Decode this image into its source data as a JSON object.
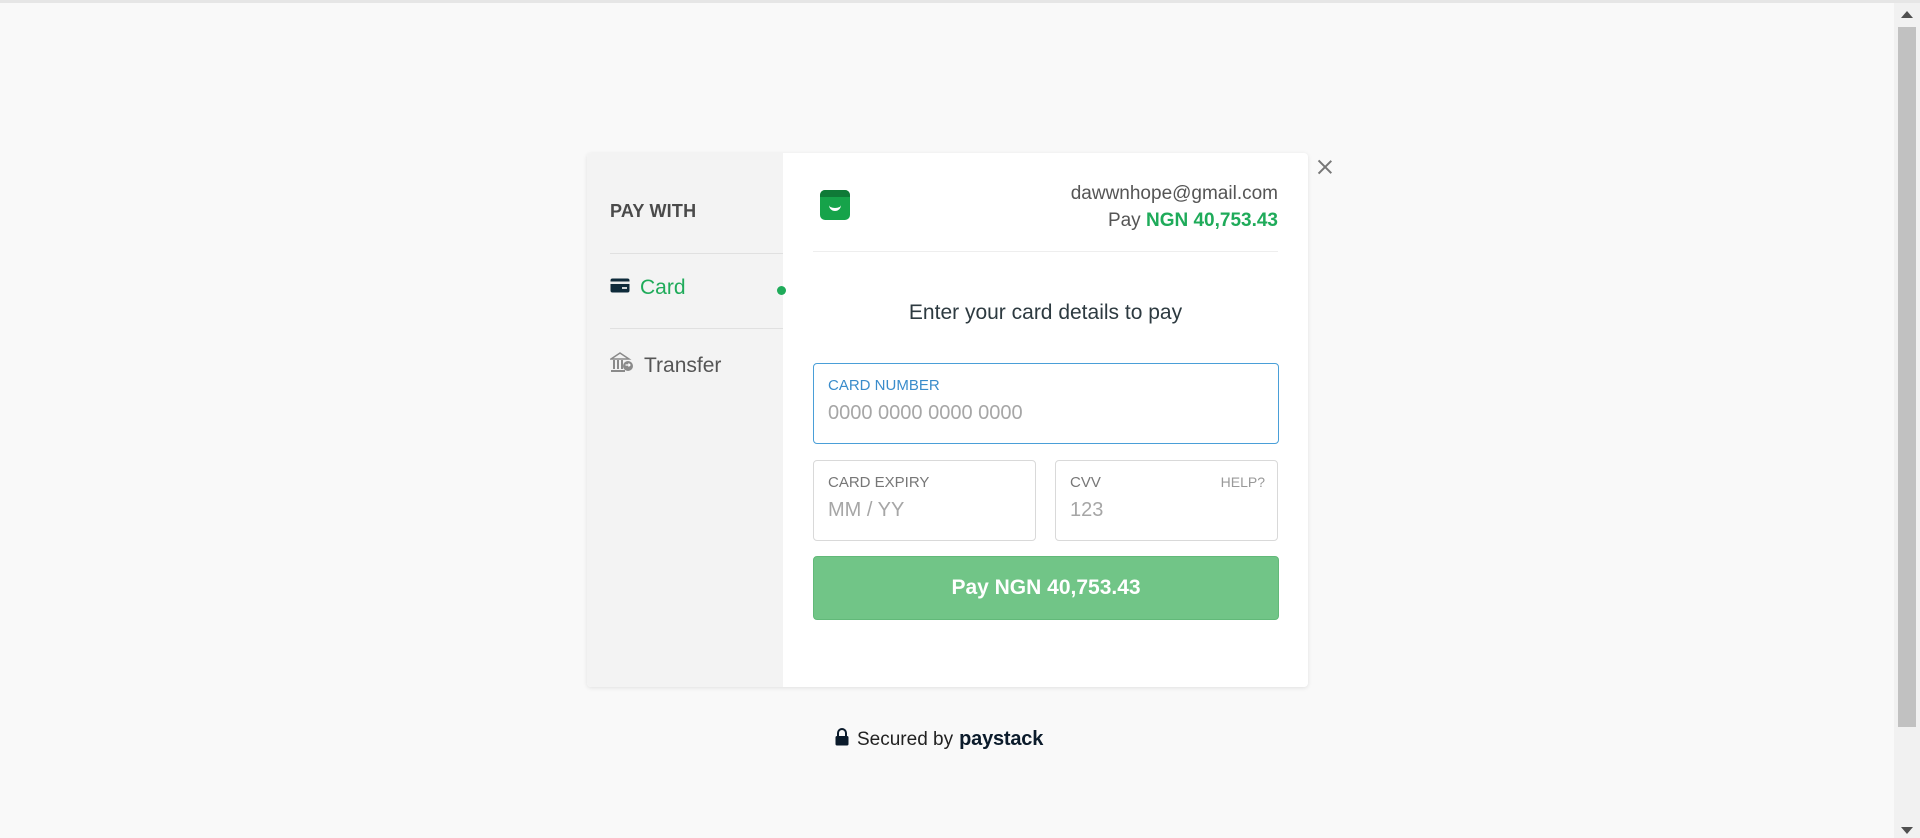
{
  "sidebar": {
    "title": "PAY WITH",
    "items": [
      {
        "label": "Card",
        "icon": "card-icon",
        "active": true
      },
      {
        "label": "Transfer",
        "icon": "bank-transfer-icon",
        "active": false
      }
    ]
  },
  "header": {
    "email": "dawwnhope@gmail.com",
    "pay_prefix": "Pay",
    "amount": "NGN 40,753.43"
  },
  "form": {
    "instruction": "Enter your card details to pay",
    "card_number": {
      "label": "CARD NUMBER",
      "placeholder": "0000 0000 0000 0000",
      "value": ""
    },
    "card_expiry": {
      "label": "CARD EXPIRY",
      "placeholder": "MM / YY",
      "value": ""
    },
    "cvv": {
      "label": "CVV",
      "placeholder": "123",
      "help": "HELP?",
      "value": ""
    },
    "pay_button": "Pay NGN 40,753.43"
  },
  "footer": {
    "secured_text": "Secured by",
    "brand": "paystack"
  },
  "colors": {
    "accent_green": "#1fab5a",
    "button_green": "#71c587",
    "focus_blue": "#4a9fd8"
  }
}
